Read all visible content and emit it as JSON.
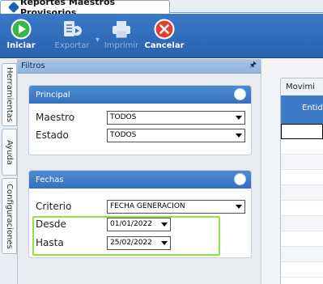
{
  "window": {
    "tab_title": "Reportes Maestros Provisorios"
  },
  "toolbar": {
    "buttons": [
      {
        "label": "Iniciar",
        "icon": "play-icon",
        "enabled": true,
        "color": "#3bb54a"
      },
      {
        "label": "Exportar",
        "icon": "export-icon",
        "enabled": false,
        "color": "#dfe9f5"
      },
      {
        "label": "Imprimir",
        "icon": "printer-icon",
        "enabled": false,
        "color": "#dfe9f5"
      },
      {
        "label": "Cancelar",
        "icon": "cancel-icon",
        "enabled": true,
        "color": "#e0402f"
      }
    ]
  },
  "side_tabs": [
    "Herramientas",
    "Ayuda",
    "Configuraciones"
  ],
  "filtros": {
    "title": "Filtros",
    "pin_icon": "pin-icon",
    "principal": {
      "title": "Principal",
      "maestro_label": "Maestro",
      "maestro_value": "TODOS",
      "estado_label": "Estado",
      "estado_value": "TODOS"
    },
    "fechas": {
      "title": "Fechas",
      "criterio_label": "Criterio",
      "criterio_value": "FECHA GENERACION",
      "desde_label": "Desde",
      "desde_value": "01/01/2022",
      "hasta_label": "Hasta",
      "hasta_value": "25/02/2022"
    }
  },
  "movimientos": {
    "tab_label": "Movimi",
    "column_header": "Entid"
  },
  "colors": {
    "accent": "#3470bf",
    "highlight": "#8ee53f"
  }
}
